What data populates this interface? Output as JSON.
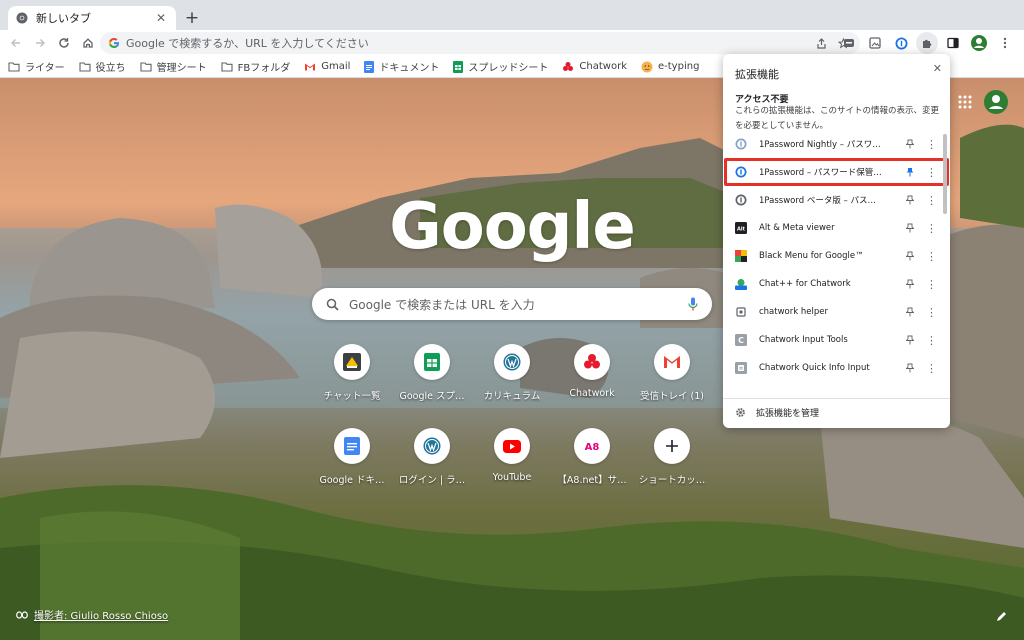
{
  "tab": {
    "title": "新しいタブ"
  },
  "omnibox": {
    "text": "Google で検索するか、URL を入力してください"
  },
  "bookmarks": [
    {
      "label": "ライター",
      "icon": "folder-icon"
    },
    {
      "label": "役立ち",
      "icon": "folder-icon"
    },
    {
      "label": "管理シート",
      "icon": "folder-icon"
    },
    {
      "label": "FBフォルダ",
      "icon": "folder-icon"
    },
    {
      "label": "Gmail",
      "icon": "gmail-icon"
    },
    {
      "label": "ドキュメント",
      "icon": "docs-icon"
    },
    {
      "label": "スプレッドシート",
      "icon": "sheets-icon"
    },
    {
      "label": "Chatwork",
      "icon": "chatwork-icon"
    },
    {
      "label": "e-typing",
      "icon": "etyping-icon"
    }
  ],
  "ntp": {
    "logo": "Google",
    "search_placeholder": "Google で検索または URL を入力",
    "tiles": [
      {
        "label": "チャット一覧"
      },
      {
        "label": "Google スプ…"
      },
      {
        "label": "カリキュラム"
      },
      {
        "label": "Chatwork"
      },
      {
        "label": "受信トレイ (1)"
      },
      {
        "label": "Google ドキ…"
      },
      {
        "label": "ログイン | ラ…"
      },
      {
        "label": "YouTube"
      },
      {
        "label": "【A8.net】サ…"
      },
      {
        "label": "ショートカッ…"
      }
    ],
    "credit": "撮影者: Giulio Rosso Chioso"
  },
  "extensions_popup": {
    "title": "拡張機能",
    "section": "アクセス不要",
    "description": "これらの拡張機能は、このサイトの情報の表示、変更を必要としていません。",
    "items": [
      {
        "name": "1Password Nightly – パスワ…",
        "pinned": false
      },
      {
        "name": "1Password – パスワード保管…",
        "pinned": true
      },
      {
        "name": "1Password ベータ版 – パス…",
        "pinned": false
      },
      {
        "name": "Alt & Meta viewer",
        "pinned": false
      },
      {
        "name": "Black Menu for Google™",
        "pinned": false
      },
      {
        "name": "Chat++ for Chatwork",
        "pinned": false
      },
      {
        "name": "chatwork helper",
        "pinned": false
      },
      {
        "name": "Chatwork Input Tools",
        "pinned": false
      },
      {
        "name": "Chatwork Quick Info Input",
        "pinned": false
      }
    ],
    "manage_label": "拡張機能を管理"
  },
  "colors": {
    "highlight": "#e5302a",
    "pin_active": "#1a73e8"
  }
}
